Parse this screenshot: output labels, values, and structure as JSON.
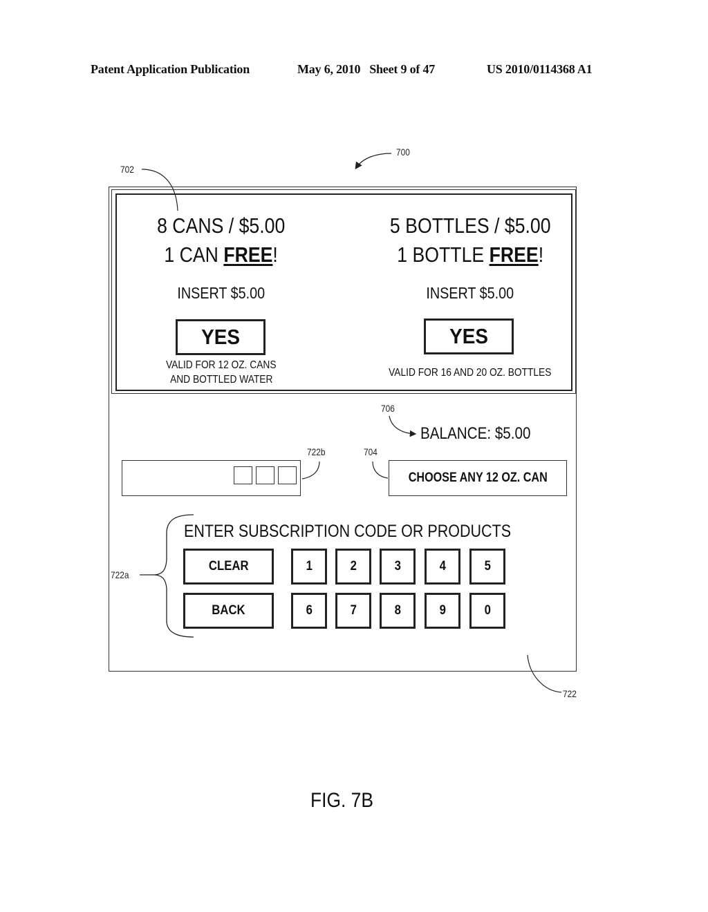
{
  "header": {
    "publication": "Patent Application Publication",
    "date_sheet": "May 6, 2010   Sheet 9 of 47",
    "patent_number": "US 2010/0114368 A1"
  },
  "reference_numerals": {
    "screen": "700",
    "offer_panel": "702",
    "balance": "706",
    "choose_prompt": "704",
    "code_display": "722b",
    "keypad": "722a",
    "input_area": "722"
  },
  "offers": [
    {
      "line1": "8 CANS / $5.00",
      "line2_prefix": "1 CAN ",
      "line2_emph": "FREE",
      "line2_suffix": "!",
      "insert": "INSERT $5.00",
      "button": "YES",
      "note_line1": "VALID FOR 12 OZ. CANS",
      "note_line2": "AND BOTTLED WATER"
    },
    {
      "line1": "5 BOTTLES / $5.00",
      "line2_prefix": "1 BOTTLE ",
      "line2_emph": "FREE",
      "line2_suffix": "!",
      "insert": "INSERT $5.00",
      "button": "YES",
      "note_line1": "VALID FOR 16 AND 20 OZ. BOTTLES"
    }
  ],
  "balance": "BALANCE: $5.00",
  "choose_prompt": "CHOOSE ANY 12 OZ. CAN",
  "keypad": {
    "title": "ENTER SUBSCRIPTION CODE OR PRODUCTS",
    "clear": "CLEAR",
    "back": "BACK",
    "row1": [
      "1",
      "2",
      "3",
      "4",
      "5"
    ],
    "row2": [
      "6",
      "7",
      "8",
      "9",
      "0"
    ]
  },
  "figure_label": "FIG. 7B"
}
